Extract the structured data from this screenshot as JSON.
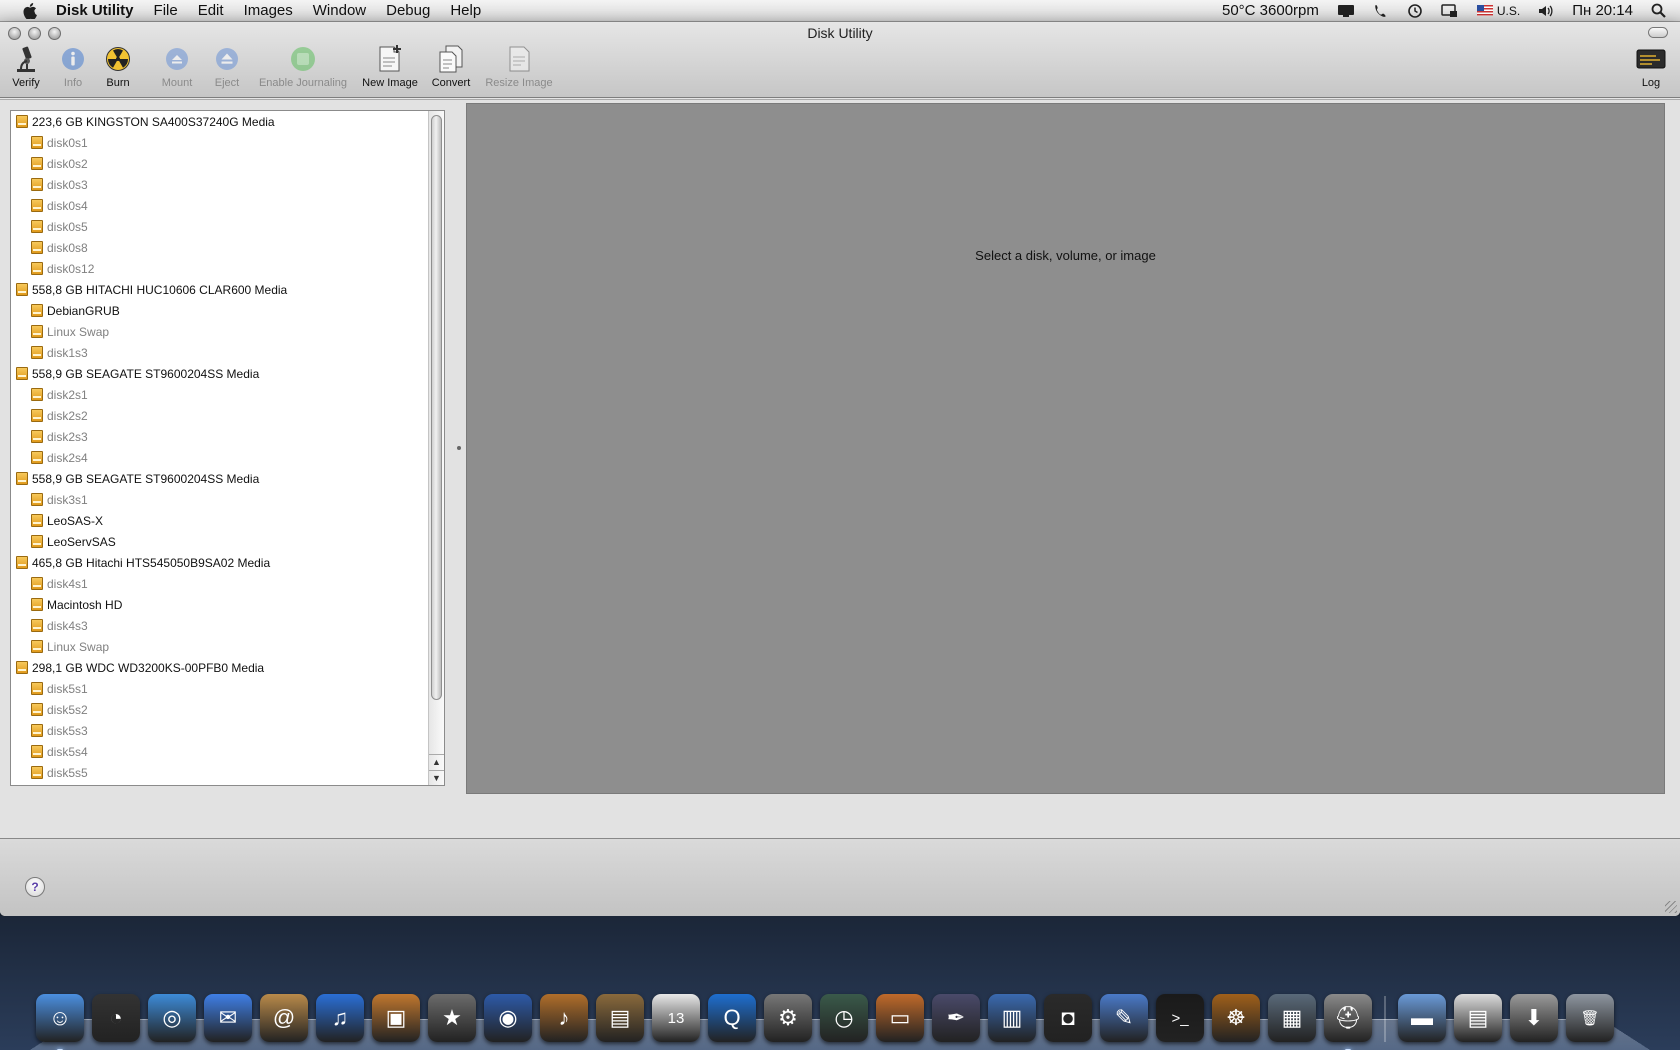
{
  "menubar": {
    "app_name": "Disk Utility",
    "menus": [
      "File",
      "Edit",
      "Images",
      "Window",
      "Debug",
      "Help"
    ],
    "status_temp": "50°C 3600rpm",
    "keyboard_layout": "U.S.",
    "clock": "Пн 20:14"
  },
  "window": {
    "title": "Disk Utility"
  },
  "toolbar": {
    "verify": "Verify",
    "info": "Info",
    "burn": "Burn",
    "mount": "Mount",
    "eject": "Eject",
    "enable_journaling": "Enable Journaling",
    "new_image": "New Image",
    "convert": "Convert",
    "resize_image": "Resize Image",
    "log": "Log"
  },
  "disks": [
    {
      "label": "223,6 GB KINGSTON SA400S37240G Media",
      "volumes": [
        {
          "label": "disk0s1",
          "mounted": false
        },
        {
          "label": "disk0s2",
          "mounted": false
        },
        {
          "label": "disk0s3",
          "mounted": false
        },
        {
          "label": "disk0s4",
          "mounted": false
        },
        {
          "label": "disk0s5",
          "mounted": false
        },
        {
          "label": "disk0s8",
          "mounted": false
        },
        {
          "label": "disk0s12",
          "mounted": false
        }
      ]
    },
    {
      "label": "558,8 GB HITACHI HUC10606 CLAR600 Media",
      "volumes": [
        {
          "label": "DebianGRUB",
          "mounted": true
        },
        {
          "label": "Linux Swap",
          "mounted": false
        },
        {
          "label": "disk1s3",
          "mounted": false
        }
      ]
    },
    {
      "label": "558,9 GB SEAGATE ST9600204SS Media",
      "volumes": [
        {
          "label": "disk2s1",
          "mounted": false
        },
        {
          "label": "disk2s2",
          "mounted": false
        },
        {
          "label": "disk2s3",
          "mounted": false
        },
        {
          "label": "disk2s4",
          "mounted": false
        }
      ]
    },
    {
      "label": "558,9 GB SEAGATE ST9600204SS Media",
      "volumes": [
        {
          "label": "disk3s1",
          "mounted": false
        },
        {
          "label": "LeoSAS-X",
          "mounted": true
        },
        {
          "label": "LeoServSAS",
          "mounted": true
        }
      ]
    },
    {
      "label": "465,8 GB Hitachi HTS545050B9SA02 Media",
      "volumes": [
        {
          "label": "disk4s1",
          "mounted": false
        },
        {
          "label": "Macintosh HD",
          "mounted": true
        },
        {
          "label": "disk4s3",
          "mounted": false
        },
        {
          "label": "Linux Swap",
          "mounted": false
        }
      ]
    },
    {
      "label": "298,1 GB WDC WD3200KS-00PFB0 Media",
      "volumes": [
        {
          "label": "disk5s1",
          "mounted": false
        },
        {
          "label": "disk5s2",
          "mounted": false
        },
        {
          "label": "disk5s3",
          "mounted": false
        },
        {
          "label": "disk5s4",
          "mounted": false
        },
        {
          "label": "disk5s5",
          "mounted": false
        }
      ]
    }
  ],
  "detail": {
    "placeholder": "Select a disk, volume, or image"
  },
  "bottom": {
    "help_label": "?"
  },
  "dock": [
    {
      "name": "finder-icon",
      "color": "#4b8fe0",
      "glyph": "☺",
      "running": true
    },
    {
      "name": "dashboard-icon",
      "color": "#333333",
      "glyph": "◔",
      "running": false
    },
    {
      "name": "safari-icon",
      "color": "#3d8bd8",
      "glyph": "◎",
      "running": false
    },
    {
      "name": "ichat-icon",
      "color": "#3f7fe6",
      "glyph": "✉",
      "running": false
    },
    {
      "name": "address-book-icon",
      "color": "#b98a4a",
      "glyph": "@",
      "running": false
    },
    {
      "name": "itunes-icon",
      "color": "#2a6fd6",
      "glyph": "♫",
      "running": false
    },
    {
      "name": "iphoto-icon",
      "color": "#c0772e",
      "glyph": "▣",
      "running": false
    },
    {
      "name": "imovie-icon",
      "color": "#6b6b6b",
      "glyph": "★",
      "running": false
    },
    {
      "name": "idvd-icon",
      "color": "#2d5aa8",
      "glyph": "◉",
      "running": false
    },
    {
      "name": "garageband-icon",
      "color": "#b06e2a",
      "glyph": "♪",
      "running": false
    },
    {
      "name": "iweb-icon",
      "color": "#8a6a3c",
      "glyph": "▤",
      "running": false
    },
    {
      "name": "ical-icon",
      "color": "#e8e8e8",
      "glyph": "13",
      "running": false
    },
    {
      "name": "quicktime-icon",
      "color": "#1e6fd0",
      "glyph": "Q",
      "running": false
    },
    {
      "name": "system-preferences-icon",
      "color": "#777777",
      "glyph": "⚙",
      "running": false
    },
    {
      "name": "time-machine-icon",
      "color": "#3a5a4a",
      "glyph": "◷",
      "running": false
    },
    {
      "name": "keynote-icon",
      "color": "#c06a2a",
      "glyph": "▭",
      "running": false
    },
    {
      "name": "script-editor-icon",
      "color": "#4a4a6a",
      "glyph": "✒",
      "running": false
    },
    {
      "name": "numbers-icon",
      "color": "#3a6ab0",
      "glyph": "▥",
      "running": false
    },
    {
      "name": "photo-booth-icon",
      "color": "#2a2a2a",
      "glyph": "◘",
      "running": false
    },
    {
      "name": "xcode-icon",
      "color": "#4a7ac8",
      "glyph": "✎",
      "running": false
    },
    {
      "name": "terminal-icon",
      "color": "#1a1a1a",
      "glyph": ">_",
      "running": false
    },
    {
      "name": "cog-icon",
      "color": "#a0601a",
      "glyph": "☸",
      "running": false
    },
    {
      "name": "activity-monitor-icon",
      "color": "#5a6a7a",
      "glyph": "▦",
      "running": false
    },
    {
      "name": "disk-utility-icon",
      "color": "#8a8a8a",
      "glyph": "⛑",
      "running": true
    },
    {
      "name": "applications-folder-icon",
      "color": "#6a9ad8",
      "glyph": "▬",
      "running": false
    },
    {
      "name": "documents-stack-icon",
      "color": "#dcdcdc",
      "glyph": "▤",
      "running": false
    },
    {
      "name": "downloads-stack-icon",
      "color": "#9a9a9a",
      "glyph": "⬇",
      "running": false
    },
    {
      "name": "trash-icon",
      "color": "#8e96a0",
      "glyph": "🗑",
      "running": false
    }
  ]
}
